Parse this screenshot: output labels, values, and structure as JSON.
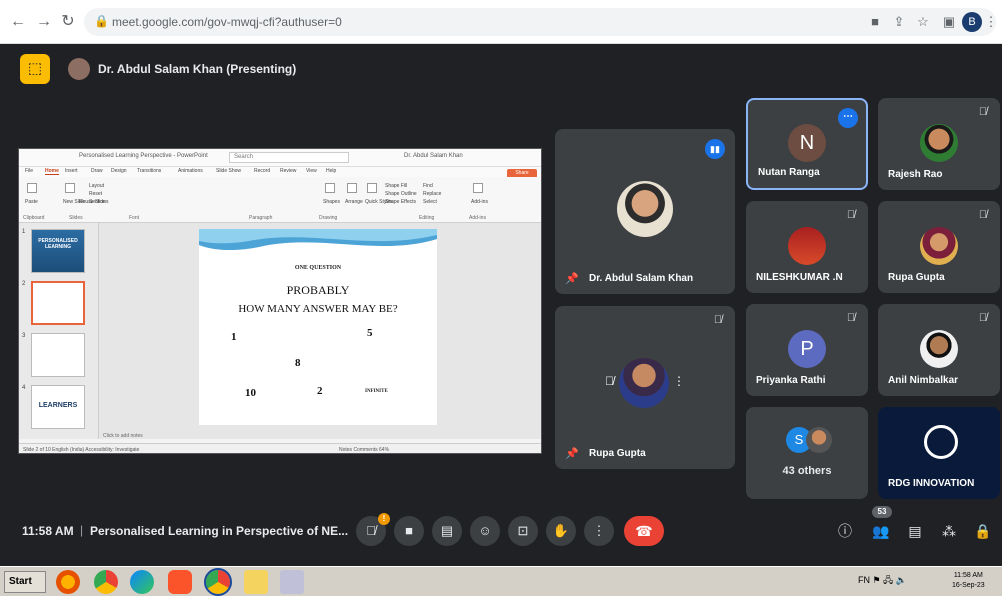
{
  "browser": {
    "url": "meet.google.com/gov-mwqj-cfi?authuser=0",
    "profile_initial": "B"
  },
  "presenter_bar": {
    "label": "Dr. Abdul Salam Khan (Presenting)"
  },
  "presentation": {
    "window_title": "Personalised Learning Perspective - PowerPoint",
    "search_placeholder": "Search",
    "user": "Dr. Abdul Salam Khan",
    "tabs": [
      "File",
      "Home",
      "Insert",
      "Draw",
      "Design",
      "Transitions",
      "Animations",
      "Slide Show",
      "Record",
      "Review",
      "View",
      "Help"
    ],
    "share_label": "Share",
    "ribbon_groups": [
      "Clipboard",
      "Slides",
      "Font",
      "Paragraph",
      "Drawing",
      "Editing",
      "Add-ins"
    ],
    "ribbon_items": [
      "Paste",
      "New Slide",
      "Reuse Slides",
      "Layout",
      "Reset",
      "Section",
      "Shapes",
      "Arrange",
      "Quick Styles",
      "Shape Fill",
      "Shape Outline",
      "Shape Effects",
      "Find",
      "Replace",
      "Select",
      "Add-ins"
    ],
    "thumbnails": [
      {
        "num": "1",
        "text": "PERSONALISED LEARNING"
      },
      {
        "num": "2",
        "text": ""
      },
      {
        "num": "3",
        "text": ""
      },
      {
        "num": "4",
        "text": "LEARNERS"
      }
    ],
    "slide": {
      "question_label": "ONE QUESTION",
      "heading": "PROBABLY",
      "subheading": "HOW MANY ANSWER MAY BE?",
      "numbers": [
        "1",
        "5",
        "8",
        "10",
        "2"
      ],
      "answer_label": "INFINITE"
    },
    "notes_placeholder": "Click to add notes",
    "status_left": "Slide 2 of 10   English (India)   Accessibility: Investigate",
    "status_right": "Notes   Comments   64%"
  },
  "participants": [
    {
      "name": "Dr. Abdul Salam Khan",
      "pinned": true,
      "speaking": true
    },
    {
      "name": "Nutan Ranga",
      "initial": "N",
      "avatar_color": "#6d4c41",
      "active": true
    },
    {
      "name": "Rajesh Rao",
      "muted": true
    },
    {
      "name": "NILESHKUMAR .N",
      "muted": true
    },
    {
      "name": "Rupa Gupta",
      "muted": true
    },
    {
      "name": "Rupa Gupta",
      "pinned": true,
      "muted": true
    },
    {
      "name": "Priyanka Rathi",
      "initial": "P",
      "avatar_color": "#5c6bc0",
      "muted": true
    },
    {
      "name": "Anil Nimbalkar",
      "muted": true
    },
    {
      "name": "43 others",
      "initial": "S",
      "avatar_color": "#1e88e5"
    },
    {
      "name": "RDG INNOVATION"
    }
  ],
  "controls": {
    "time": "11:58 AM",
    "separator": "|",
    "meeting_title": "Personalised Learning in Perspective of NE...",
    "mic_badge": "!",
    "people_count": "53"
  },
  "taskbar": {
    "start_label": "Start",
    "tray_text": "FN",
    "clock_time": "11:58 AM",
    "clock_date": "16-Sep-23"
  },
  "colors": {
    "meet_bg": "#202124",
    "tile_bg": "#3c4043",
    "present_accent": "#fbbc04",
    "end_call": "#ea4335",
    "active_border": "#8ab4f8",
    "ppt_accent": "#c43e1c"
  }
}
